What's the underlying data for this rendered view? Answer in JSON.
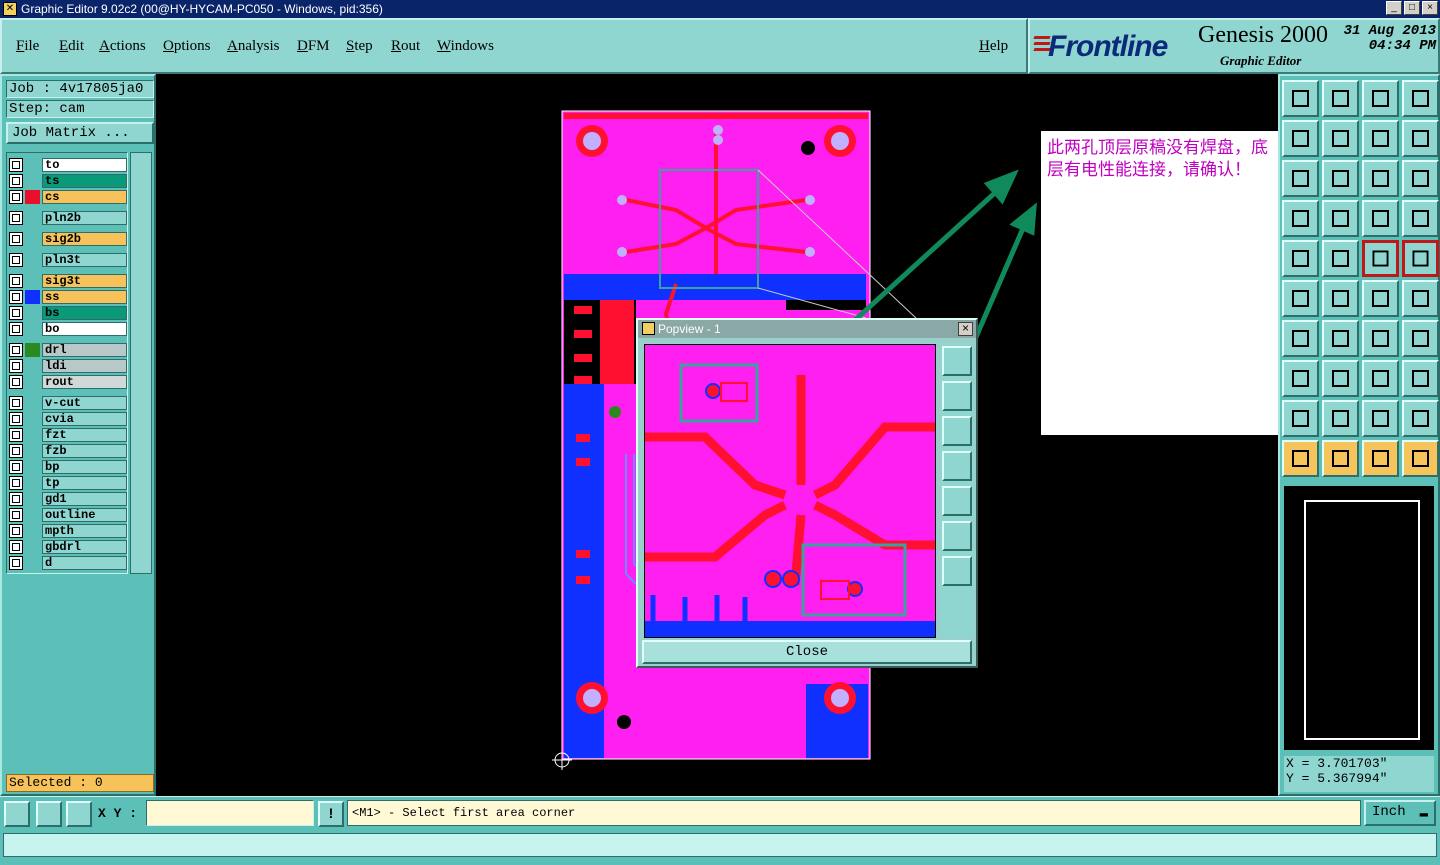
{
  "window": {
    "title": "Graphic Editor 9.02c2 (00@HY-HYCAM-PC050 - Windows, pid:356)",
    "controls": [
      "_",
      "□",
      "×"
    ]
  },
  "menu": {
    "items": [
      "File",
      "Edit",
      "Actions",
      "Options",
      "Analysis",
      "DFM",
      "Step",
      "Rout",
      "Windows"
    ],
    "help": "Help"
  },
  "brand": {
    "logo": "Frontline",
    "product": "Genesis 2000",
    "subtitle": "Graphic Editor",
    "date": "31 Aug 2013",
    "time": "04:34 PM"
  },
  "job": {
    "job_label": "Job : 4v17805ja0",
    "step_label": "Step: cam",
    "job_matrix": "Job Matrix ..."
  },
  "layers": [
    {
      "name": "to",
      "bg": "#ffffff",
      "swatch": "",
      "group": 0
    },
    {
      "name": "ts",
      "bg": "#0a9a7a",
      "swatch": "",
      "group": 0
    },
    {
      "name": "cs",
      "bg": "#f7c25a",
      "swatch": "#e8102a",
      "group": 0
    },
    {
      "name": "pln2b",
      "bg": "#8fd6d0",
      "swatch": "",
      "group": 1
    },
    {
      "name": "sig2b",
      "bg": "#f7c25a",
      "swatch": "",
      "group": 2
    },
    {
      "name": "pln3t",
      "bg": "#8fd6d0",
      "swatch": "",
      "group": 3
    },
    {
      "name": "sig3t",
      "bg": "#f7c25a",
      "swatch": "",
      "group": 4
    },
    {
      "name": "ss",
      "bg": "#f7c25a",
      "swatch": "#1030ff",
      "group": 4
    },
    {
      "name": "bs",
      "bg": "#0a9a7a",
      "swatch": "",
      "group": 4
    },
    {
      "name": "bo",
      "bg": "#ffffff",
      "swatch": "",
      "group": 4
    },
    {
      "name": "drl",
      "bg": "#b8c8c8",
      "swatch": "#2a8a20",
      "group": 5
    },
    {
      "name": "ldi",
      "bg": "#b8c8c8",
      "swatch": "",
      "group": 5
    },
    {
      "name": "rout",
      "bg": "#d0d8d8",
      "swatch": "",
      "group": 5
    },
    {
      "name": "v-cut",
      "bg": "#8fd6d0",
      "swatch": "",
      "group": 6
    },
    {
      "name": "cvia",
      "bg": "#8fd6d0",
      "swatch": "",
      "group": 6
    },
    {
      "name": "fzt",
      "bg": "#8fd6d0",
      "swatch": "",
      "group": 6
    },
    {
      "name": "fzb",
      "bg": "#8fd6d0",
      "swatch": "",
      "group": 6
    },
    {
      "name": "bp",
      "bg": "#8fd6d0",
      "swatch": "",
      "group": 6
    },
    {
      "name": "tp",
      "bg": "#8fd6d0",
      "swatch": "",
      "group": 6
    },
    {
      "name": "gd1",
      "bg": "#8fd6d0",
      "swatch": "",
      "group": 6
    },
    {
      "name": "outline",
      "bg": "#8fd6d0",
      "swatch": "",
      "group": 6
    },
    {
      "name": "mpth",
      "bg": "#8fd6d0",
      "swatch": "",
      "group": 6
    },
    {
      "name": "gbdrl",
      "bg": "#8fd6d0",
      "swatch": "",
      "group": 6
    },
    {
      "name": "d",
      "bg": "#8fd6d0",
      "swatch": "",
      "group": 6
    }
  ],
  "selected": "Selected : 0",
  "popview": {
    "title": "Popview - 1",
    "close_label": "Close"
  },
  "note": {
    "text": "此两孔顶层原稿没有焊盘，底层有电性能连接，请确认！"
  },
  "coords": {
    "x": "X = 3.701703\"",
    "y": "Y = 5.367994\""
  },
  "status": {
    "xy_label": "X Y :",
    "xy_value": "",
    "prompt": "<M1> - Select first area corner",
    "units": "Inch"
  },
  "colors": {
    "panel": "#5cc0b8",
    "pcb_magenta": "#ff1ff0",
    "pcb_blue": "#1030ff",
    "pcb_red": "#ff1030",
    "annotation_green": "#108a5a",
    "note_text": "#c000c0"
  }
}
